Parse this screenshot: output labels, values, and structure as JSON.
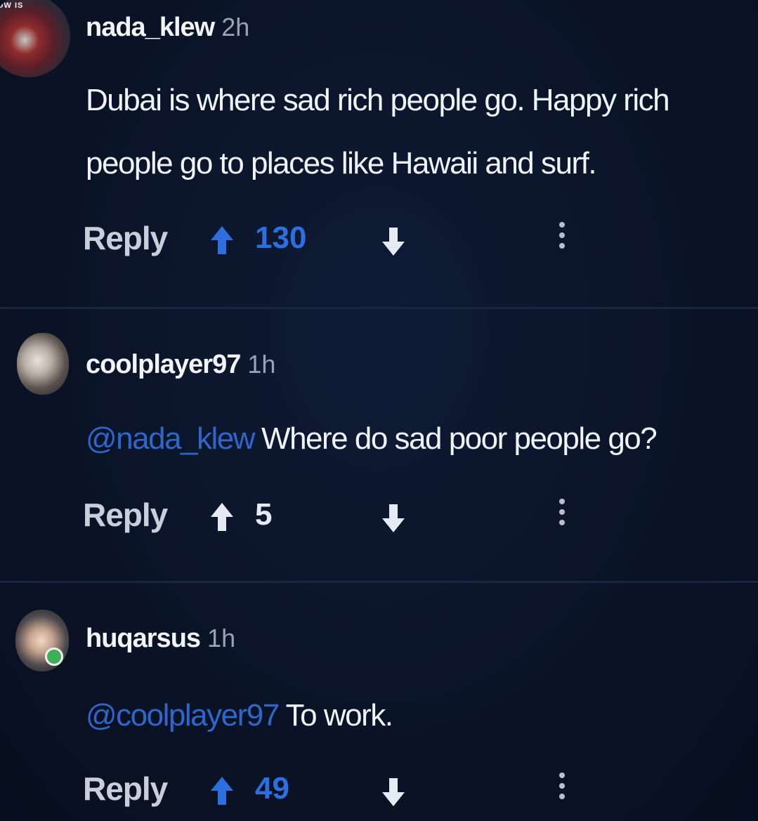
{
  "comments": [
    {
      "username": "nada_klew",
      "time": "2h",
      "flair": "OW IS",
      "mention": "",
      "text": "Dubai is where sad rich people go. Happy rich people go to places like Hawaii and surf.",
      "reply_label": "Reply",
      "score": "130",
      "upvoted": true
    },
    {
      "username": "coolplayer97",
      "time": "1h",
      "mention": "@nada_klew",
      "text": "Where do sad poor people go?",
      "reply_label": "Reply",
      "score": "5",
      "upvoted": false
    },
    {
      "username": "huqarsus",
      "time": "1h",
      "mention": "@coolplayer97",
      "text": "To work.",
      "reply_label": "Reply",
      "score": "49",
      "upvoted": true,
      "online_badge": true
    }
  ],
  "icons": {
    "upvote": "arrow-up-icon",
    "downvote": "arrow-down-icon",
    "more": "more-vertical-icon"
  },
  "colors": {
    "background": "#0b1428",
    "upvoted_blue": "#2e6fe0",
    "mention_blue": "#2f66c9",
    "online_green": "#3fae5b"
  }
}
